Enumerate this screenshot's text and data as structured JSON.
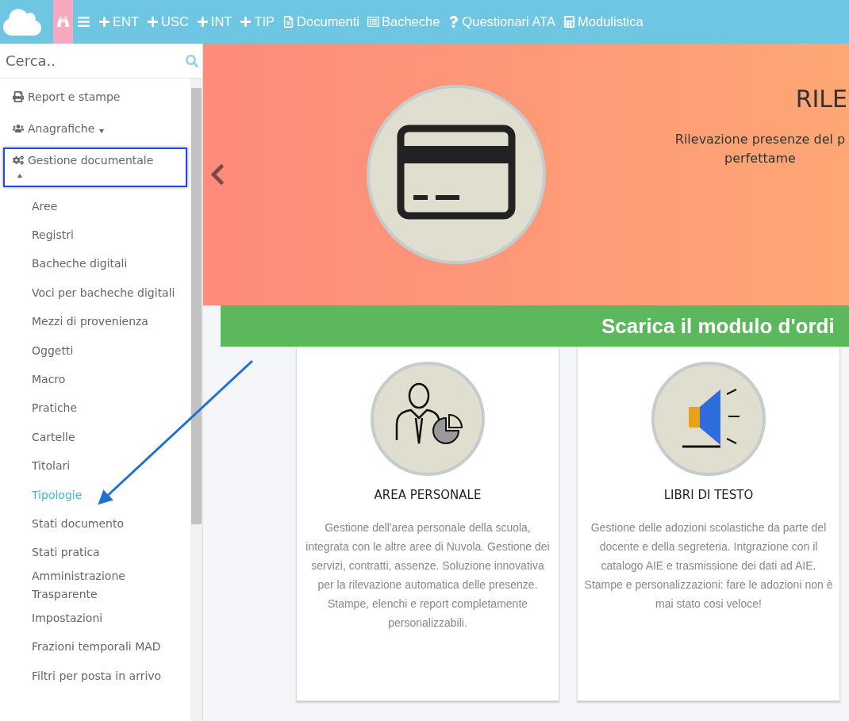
{
  "topbar": {
    "items": [
      {
        "kind": "binoculars",
        "selected": true
      },
      {
        "kind": "menu",
        "selected": false
      },
      {
        "kind": "plus",
        "label": "ENT",
        "selected": false
      },
      {
        "kind": "plus",
        "label": "USC",
        "selected": false
      },
      {
        "kind": "plus",
        "label": "INT",
        "selected": false
      },
      {
        "kind": "plus",
        "label": "TIP",
        "selected": false
      },
      {
        "kind": "file",
        "label": "Documenti",
        "selected": false
      },
      {
        "kind": "board",
        "label": "Bacheche",
        "selected": false
      },
      {
        "kind": "question",
        "label": "Questionari ATA",
        "selected": false
      },
      {
        "kind": "calculator",
        "label": "Modulistica",
        "selected": false
      }
    ]
  },
  "search": {
    "placeholder": "Cerca.."
  },
  "sidebar": {
    "items": [
      {
        "kind": "print",
        "label": "Report e stampe",
        "highlighted": false
      },
      {
        "kind": "users",
        "label": "Anagrafiche",
        "expanded": false,
        "highlighted": false
      },
      {
        "kind": "gears",
        "label": "Gestione documentale",
        "expanded": true,
        "highlighted": true,
        "children": [
          {
            "label": "Aree",
            "selected": false
          },
          {
            "label": "Registri",
            "selected": false
          },
          {
            "label": "Bacheche digitali",
            "selected": false
          },
          {
            "label": "Voci per bacheche digitali",
            "selected": false
          },
          {
            "label": "Mezzi di provenienza",
            "selected": false
          },
          {
            "label": "Oggetti",
            "selected": false
          },
          {
            "label": "Macro",
            "selected": false
          },
          {
            "label": "Pratiche",
            "selected": false
          },
          {
            "label": "Cartelle",
            "selected": false
          },
          {
            "label": "Titolari",
            "selected": false
          },
          {
            "label": "Tipologie",
            "selected": true
          },
          {
            "label": "Stati documento",
            "selected": false
          },
          {
            "label": "Stati pratica",
            "selected": false
          },
          {
            "label": "Amministrazione Trasparente",
            "selected": false
          },
          {
            "label": "Impostazioni",
            "selected": false
          },
          {
            "label": "Frazioni temporali MAD",
            "selected": false
          },
          {
            "label": "Filtri per posta in arrivo",
            "selected": false
          }
        ]
      }
    ]
  },
  "banner": {
    "title": "RILE",
    "lines": [
      "Rilevazione presenze del p",
      "perfettame"
    ]
  },
  "cta": {
    "label": "Scarica il modulo d'ordi"
  },
  "cards": [
    {
      "kind": "person",
      "title": "AREA PERSONALE",
      "text": "Gestione dell'area personale della scuola, integrata con le altre aree di Nuvola. Gestione dei servizi, contratti, assenze. Soluzione innovativa per la rilevazione automatica delle presenze. Stampe, elenchi e report completamente personalizzabili."
    },
    {
      "kind": "megaphone",
      "title": "LIBRI DI TESTO",
      "text": "Gestione delle adozioni scolastiche da parte del docente e della segreteria. Intgrazione con il catalogo AIE e trasmissione dei dati ad AIE. Stampe e personalizzazioni: fare le adozioni non è mai stato cosi veloce!"
    }
  ]
}
